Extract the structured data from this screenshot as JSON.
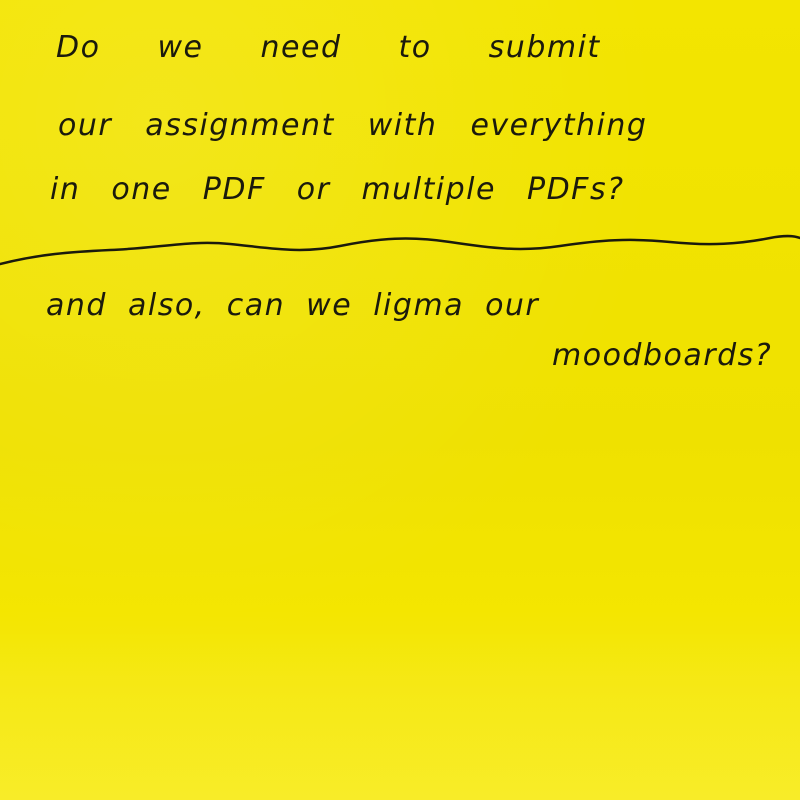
{
  "note": {
    "background_color": "#efe100",
    "ink_color": "#1b1a0c",
    "question_lines": [
      "Do we need to submit",
      "our assignment with everything",
      "in one PDF or multiple PDFs?"
    ],
    "followup_lines": [
      "and also, can we ligma our",
      "moodboards?"
    ]
  }
}
